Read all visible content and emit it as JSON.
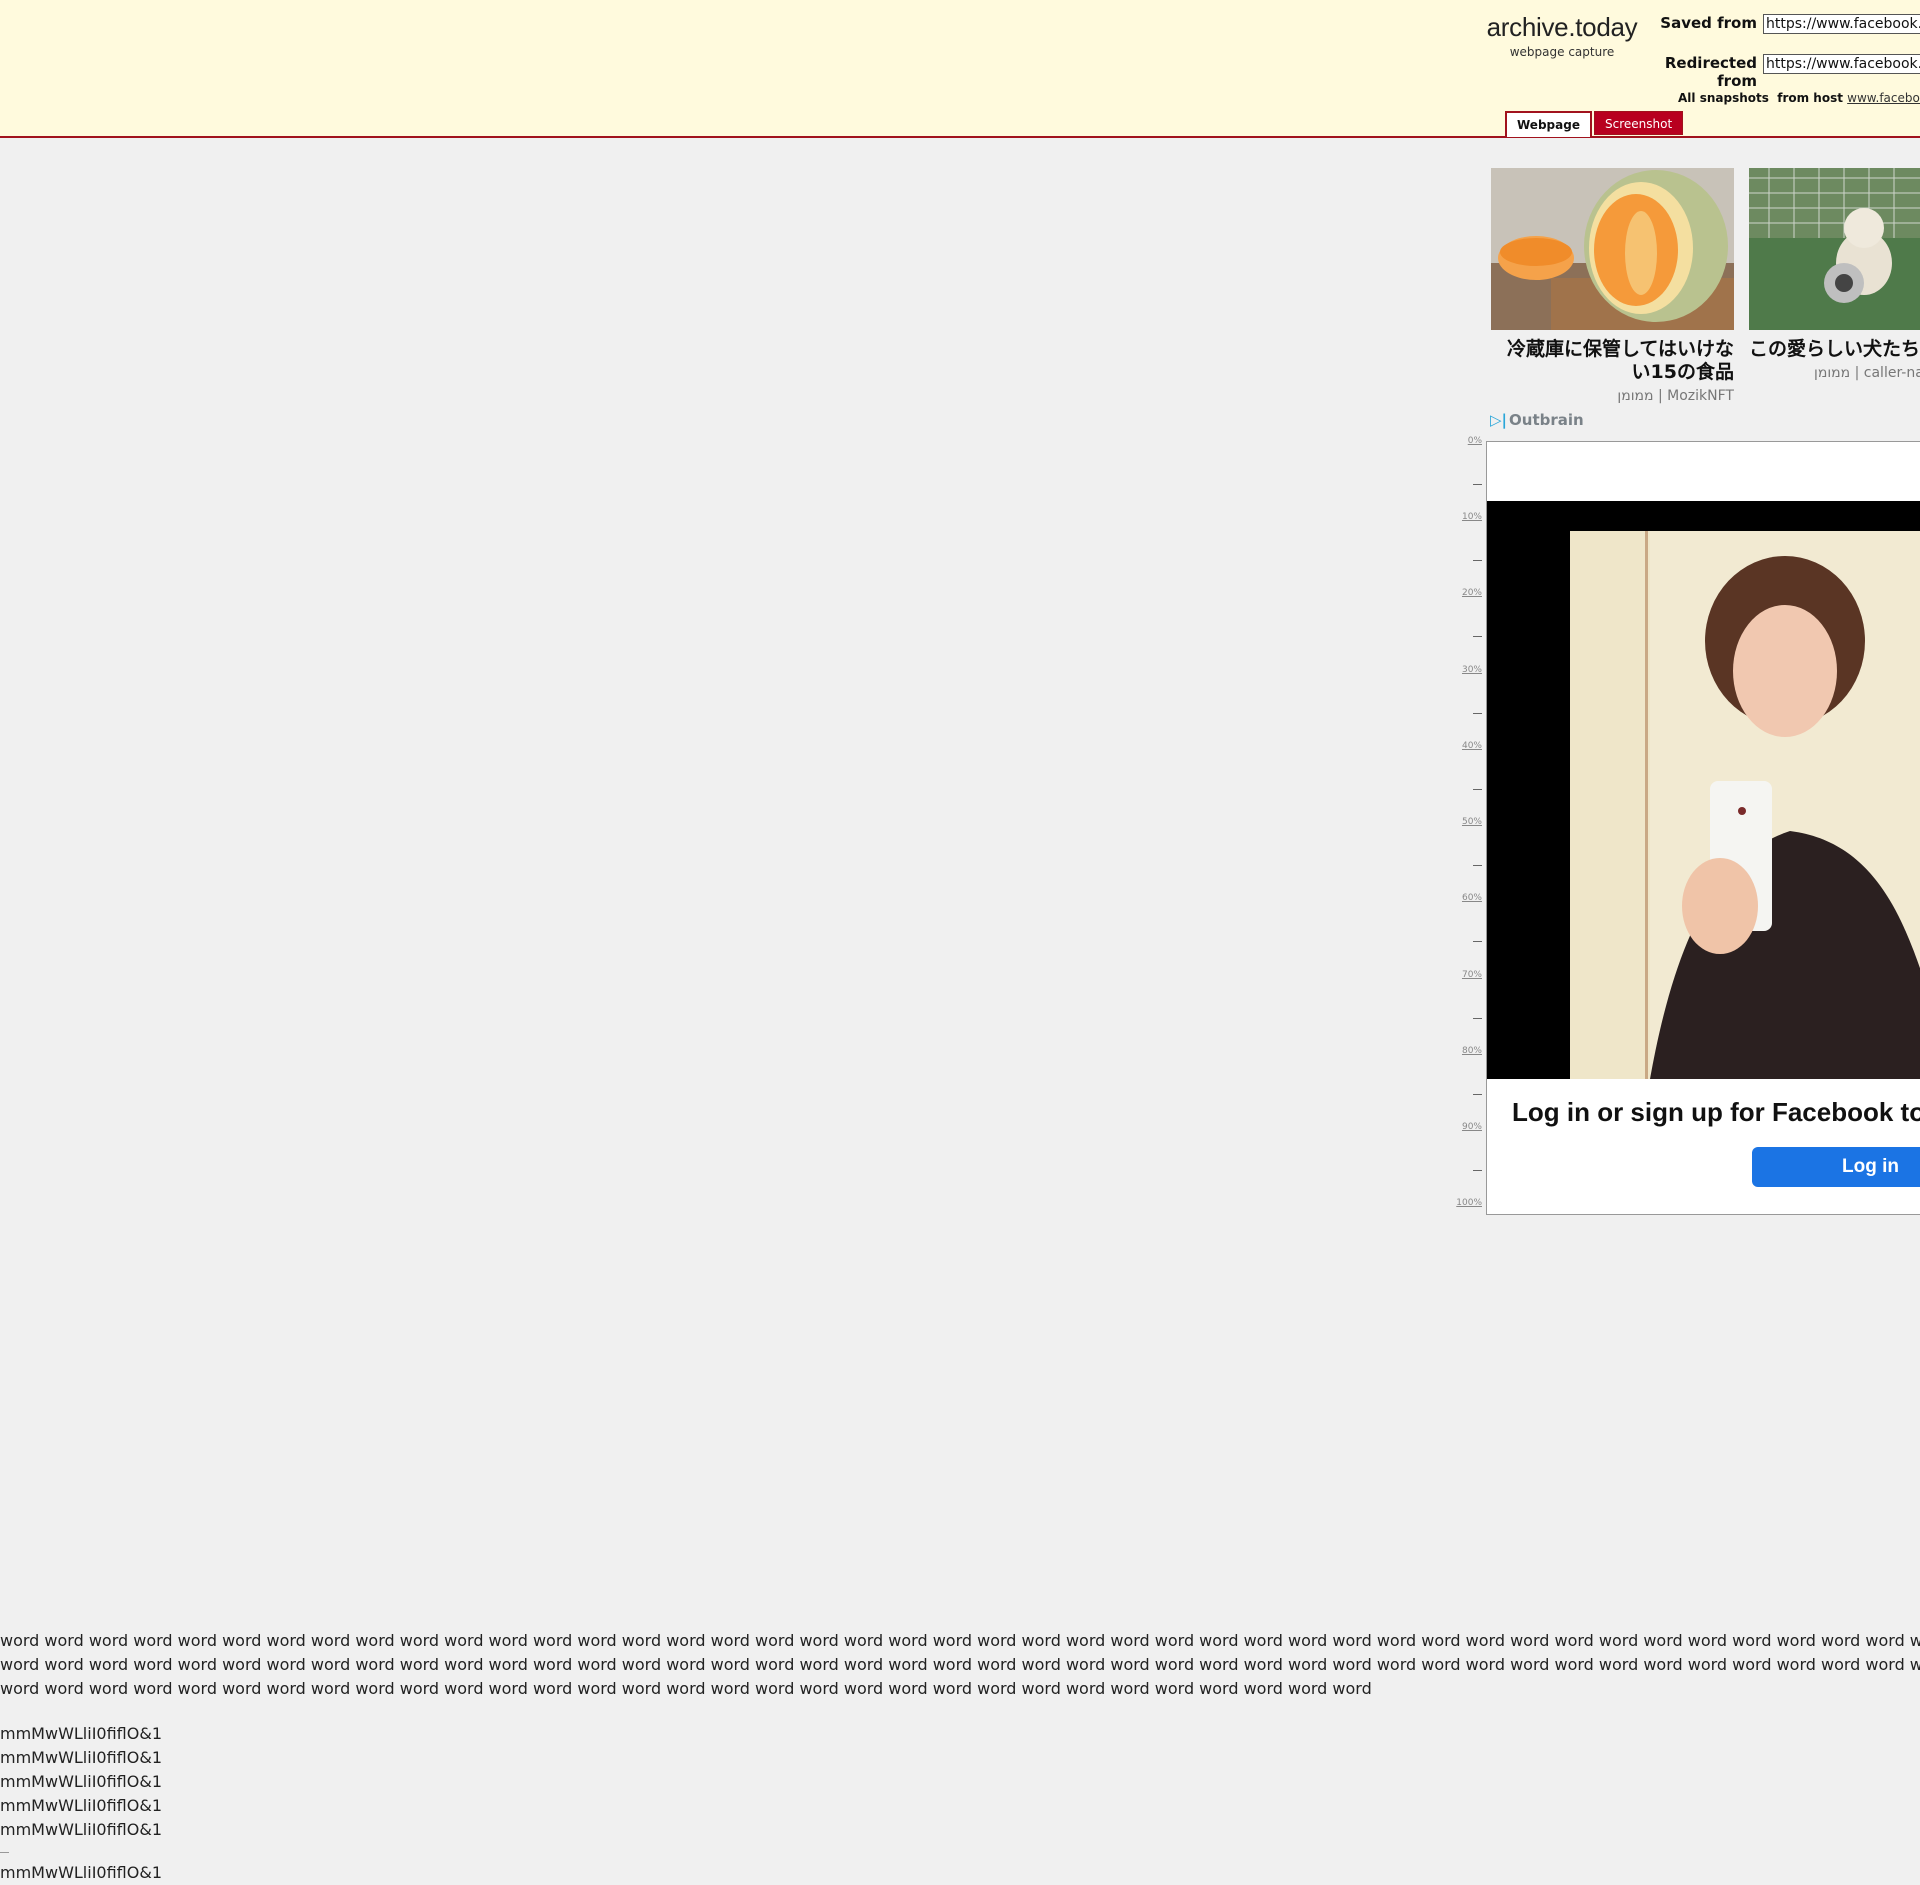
{
  "header": {
    "brand": "archive.today",
    "brand_sub": "webpage capture",
    "saved_from_label": "Saved from",
    "saved_from_value": "https://www.facebook.com",
    "redirected_from_label": "Redirected from",
    "redirected_from_value": "https://www.facebook.com",
    "all_snapshots_label": "All snapshots",
    "from_host_label": "from host",
    "host_link": "www.facebook.com",
    "tabs": [
      "Webpage",
      "Screenshot"
    ]
  },
  "outbrain": {
    "cards": [
      {
        "title": "冷蔵庫に保管してはいけない15の食品",
        "source": "ממומן | MozikNFT"
      },
      {
        "title": "この愛らしい犬たち…してあなたを元気",
        "source": "ממומן | caller-na"
      }
    ],
    "logo": "Outbrain"
  },
  "scale": {
    "labels": [
      "0%",
      "10%",
      "20%",
      "30%",
      "40%",
      "50%",
      "60%",
      "70%",
      "80%",
      "90%",
      "100%"
    ]
  },
  "facebook": {
    "cta": "Log in or sign up for Facebook to co",
    "login_button": "Log in"
  },
  "test_text": {
    "paragraph": "word word word word word word word word word word word word word word word word word word word word word word word word word word word word word word word word word word word word word word word word word word word word word word word word word word word word word word word word word word word word word word word word word word word word word word word word word word word word word word word word word word word word word word word word word word word word word word word word word word word word word word word word word word word word word word word word word word word word word word word word word word word word word",
    "glyph_lines": [
      "mmMwWLliI0fiflO&1",
      "mmMwWLliI0fiflO&1",
      "mmMwWLliI0fiflO&1",
      "mmMwWLliI0fiflO&1",
      "mmMwWLliI0fiflO&1"
    ],
    "glyph_line_after_sep": "mmMwWLliI0fiflO&1"
  }
}
